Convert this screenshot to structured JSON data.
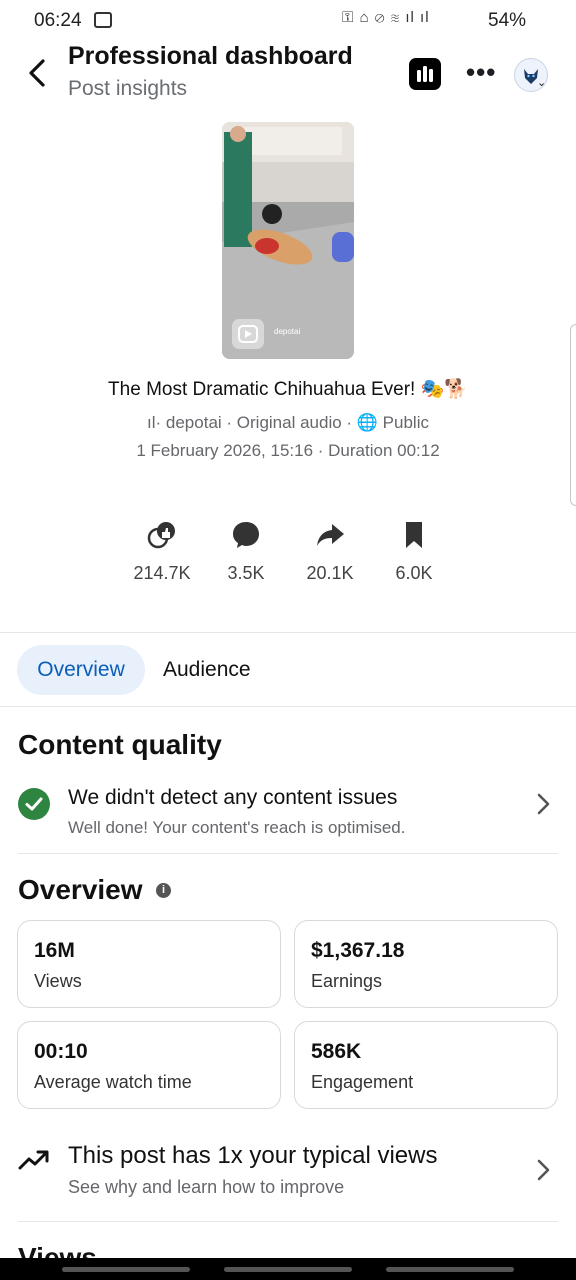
{
  "status_bar": {
    "time": "06:24",
    "signal_icons": "⚿ ⌂ ⊘ ≋ ıl ıl",
    "battery": "54%"
  },
  "header": {
    "title": "Professional dashboard",
    "subtitle": "Post insights"
  },
  "post": {
    "thumbnail_watermark": "depotai",
    "title": "The Most Dramatic Chihuahua Ever! 🎭🐕",
    "meta_line1": "ıl· depotai · Original audio · 🌐 Public",
    "meta_line2": "1 February 2026, 15:16 · Duration 00:12"
  },
  "stats": [
    {
      "icon": "reactions-icon",
      "value": "214.7K"
    },
    {
      "icon": "comment-icon",
      "value": "3.5K"
    },
    {
      "icon": "share-icon",
      "value": "20.1K"
    },
    {
      "icon": "save-icon",
      "value": "6.0K"
    }
  ],
  "tabs": [
    {
      "label": "Overview",
      "selected": true
    },
    {
      "label": "Audience",
      "selected": false
    }
  ],
  "content_quality": {
    "heading": "Content quality",
    "title": "We didn't detect any content issues",
    "subtitle": "Well done! Your content's reach is optimised."
  },
  "overview": {
    "heading": "Overview",
    "info_glyph": "i",
    "cards": [
      {
        "value": "16M",
        "label": "Views"
      },
      {
        "value": "$1,367.18",
        "label": "Earnings"
      },
      {
        "value": "00:10",
        "label": "Average watch time"
      },
      {
        "value": "586K",
        "label": "Engagement"
      }
    ]
  },
  "typical_views": {
    "title": "This post has 1x your typical views",
    "subtitle": "See why and learn how to improve"
  },
  "next_section": {
    "heading": "Views"
  },
  "colors": {
    "accent": "#0a5eb8",
    "success": "#2e8540",
    "tab_bg": "#e7f0fb"
  }
}
